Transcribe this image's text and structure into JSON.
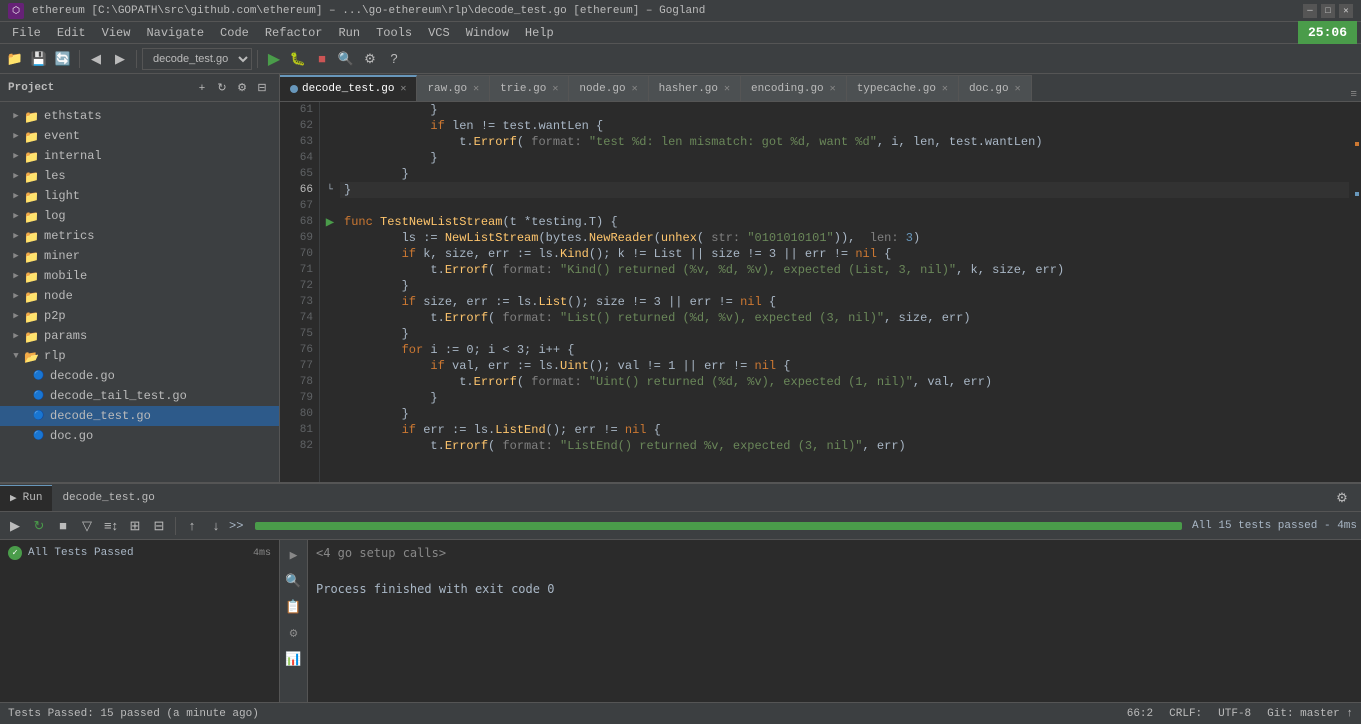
{
  "titlebar": {
    "title": "ethereum [C:\\GOPATH\\src\\github.com\\ethereum] – ...\\go-ethereum\\rlp\\decode_test.go [ethereum] – Gogland",
    "icon": "⬡",
    "btn_minimize": "─",
    "btn_maximize": "□",
    "btn_close": "✕"
  },
  "menubar": {
    "items": [
      "File",
      "Edit",
      "View",
      "Navigate",
      "Code",
      "Refactor",
      "Run",
      "Tools",
      "VCS",
      "Window",
      "Help"
    ]
  },
  "toolbar": {
    "clock": "25:06",
    "file_dropdown": "decode_test.go"
  },
  "tabs": [
    {
      "label": "decode_test.go",
      "active": true,
      "has_dot": true
    },
    {
      "label": "raw.go",
      "active": false
    },
    {
      "label": "trie.go",
      "active": false
    },
    {
      "label": "node.go",
      "active": false
    },
    {
      "label": "hasher.go",
      "active": false
    },
    {
      "label": "encoding.go",
      "active": false
    },
    {
      "label": "typecache.go",
      "active": false
    },
    {
      "label": "doc.go",
      "active": false
    }
  ],
  "sidebar": {
    "title": "Project",
    "tree": [
      {
        "level": 0,
        "type": "folder",
        "label": "ethstats",
        "expanded": false
      },
      {
        "level": 0,
        "type": "folder",
        "label": "event",
        "expanded": false
      },
      {
        "level": 0,
        "type": "folder",
        "label": "internal",
        "expanded": false
      },
      {
        "level": 0,
        "type": "folder",
        "label": "les",
        "expanded": false
      },
      {
        "level": 0,
        "type": "folder",
        "label": "light",
        "expanded": false,
        "selected": false
      },
      {
        "level": 0,
        "type": "folder",
        "label": "log",
        "expanded": false
      },
      {
        "level": 0,
        "type": "folder",
        "label": "metrics",
        "expanded": false
      },
      {
        "level": 0,
        "type": "folder",
        "label": "miner",
        "expanded": false
      },
      {
        "level": 0,
        "type": "folder",
        "label": "mobile",
        "expanded": false
      },
      {
        "level": 0,
        "type": "folder",
        "label": "node",
        "expanded": false
      },
      {
        "level": 0,
        "type": "folder",
        "label": "p2p",
        "expanded": false
      },
      {
        "level": 0,
        "type": "folder",
        "label": "params",
        "expanded": false
      },
      {
        "level": 0,
        "type": "folder",
        "label": "rlp",
        "expanded": true
      },
      {
        "level": 1,
        "type": "file",
        "label": "decode.go"
      },
      {
        "level": 1,
        "type": "file",
        "label": "decode_tail_test.go",
        "selected": false
      },
      {
        "level": 1,
        "type": "file",
        "label": "decode_test.go",
        "active": true
      },
      {
        "level": 1,
        "type": "file",
        "label": "doc.go"
      }
    ]
  },
  "code": {
    "lines": [
      {
        "num": 61,
        "content": "            }",
        "indent": 3
      },
      {
        "num": 62,
        "content": "            if len != test.wantLen {",
        "indent": 3
      },
      {
        "num": 63,
        "content": "                t.Errorf( format: \"test %d: len mismatch: got %d, want %d\", i, len, test.wantLen)",
        "indent": 4
      },
      {
        "num": 64,
        "content": "            }",
        "indent": 3
      },
      {
        "num": 65,
        "content": "        }",
        "indent": 2
      },
      {
        "num": 66,
        "content": "}",
        "indent": 0,
        "active": true
      },
      {
        "num": 67,
        "content": "",
        "indent": 0
      },
      {
        "num": 68,
        "content": "func TestNewListStream(t *testing.T) {",
        "indent": 0,
        "has_icon": true
      },
      {
        "num": 69,
        "content": "        ls := NewListStream(bytes.NewReader(unhex( str: \"0101010101\")),  len: 3)",
        "indent": 2
      },
      {
        "num": 70,
        "content": "        if k, size, err := ls.Kind(); k != List || size != 3 || err != nil {",
        "indent": 2
      },
      {
        "num": 71,
        "content": "            t.Errorf( format: \"Kind() returned (%v, %d, %v), expected (List, 3, nil)\", k, size, err)",
        "indent": 3
      },
      {
        "num": 72,
        "content": "        }",
        "indent": 2
      },
      {
        "num": 73,
        "content": "        if size, err := ls.List(); size != 3 || err != nil {",
        "indent": 2
      },
      {
        "num": 74,
        "content": "            t.Errorf( format: \"List() returned (%d, %v), expected (3, nil)\", size, err)",
        "indent": 3
      },
      {
        "num": 75,
        "content": "        }",
        "indent": 2
      },
      {
        "num": 76,
        "content": "        for i := 0; i < 3; i++ {",
        "indent": 2
      },
      {
        "num": 77,
        "content": "            if val, err := ls.Uint(); val != 1 || err != nil {",
        "indent": 3
      },
      {
        "num": 78,
        "content": "                t.Errorf( format: \"Uint() returned (%d, %v), expected (1, nil)\", val, err)",
        "indent": 4
      },
      {
        "num": 79,
        "content": "            }",
        "indent": 3
      },
      {
        "num": 80,
        "content": "        }",
        "indent": 2
      },
      {
        "num": 81,
        "content": "        if err := ls.ListEnd(); err != nil {",
        "indent": 2
      },
      {
        "num": 82,
        "content": "            t.Errorf( format: \"ListEnd() returned %v, expected (3, nil)\", err)",
        "indent": 3
      }
    ]
  },
  "bottom_panel": {
    "run_tab": "Run",
    "file_tab": "decode_test.go",
    "test_result": "All 15 tests passed - 4ms",
    "progress": 100,
    "run_items": [
      {
        "label": "All Tests Passed",
        "time": "4ms",
        "status": "pass"
      }
    ],
    "output_lines": [
      {
        "text": "<4 go setup calls>",
        "type": "normal"
      },
      {
        "text": "",
        "type": "normal"
      },
      {
        "text": "Process finished with exit code 0",
        "type": "normal"
      }
    ]
  },
  "statusbar": {
    "tests": "Tests Passed: 15 passed (a minute ago)",
    "position": "66:2",
    "line_ending": "CRLF:",
    "encoding": "UTF-8",
    "git": "Git: master ↑"
  }
}
